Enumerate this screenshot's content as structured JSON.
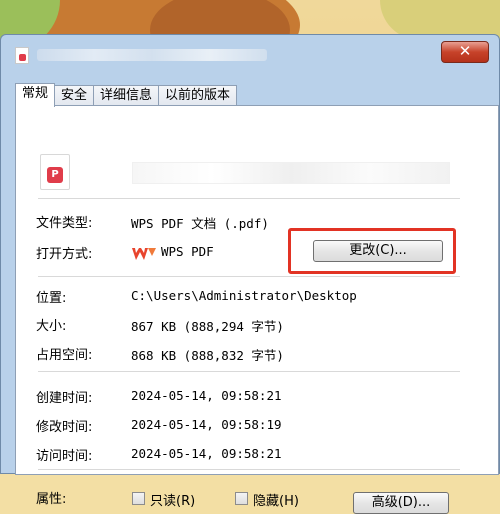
{
  "dialog": {
    "close_glyph": "✕"
  },
  "tabs": [
    "常规",
    "安全",
    "详细信息",
    "以前的版本"
  ],
  "file_icon_mark": "P",
  "rows": {
    "file_type": {
      "label": "文件类型:",
      "value": "WPS PDF 文档 (.pdf)"
    },
    "open_with": {
      "label": "打开方式:",
      "value": "WPS PDF",
      "button": "更改(C)..."
    },
    "location": {
      "label": "位置:",
      "value": "C:\\Users\\Administrator\\Desktop"
    },
    "size": {
      "label": "大小:",
      "value": "867 KB (888,294 字节)"
    },
    "size_on_disk": {
      "label": "占用空间:",
      "value": "868 KB (888,832 字节)"
    },
    "created": {
      "label": "创建时间:",
      "value": "2024-05-14, 09:58:21"
    },
    "modified": {
      "label": "修改时间:",
      "value": "2024-05-14, 09:58:19"
    },
    "accessed": {
      "label": "访问时间:",
      "value": "2024-05-14, 09:58:21"
    }
  },
  "attributes": {
    "label": "属性:",
    "readonly": "只读(R)",
    "hidden": "隐藏(H)",
    "advanced": "高级(D)..."
  },
  "colors": {
    "highlight": "#e23324",
    "close_button": "#c7432a",
    "pdf_red": "#e03c4a",
    "wps_red": "#e8442d"
  }
}
